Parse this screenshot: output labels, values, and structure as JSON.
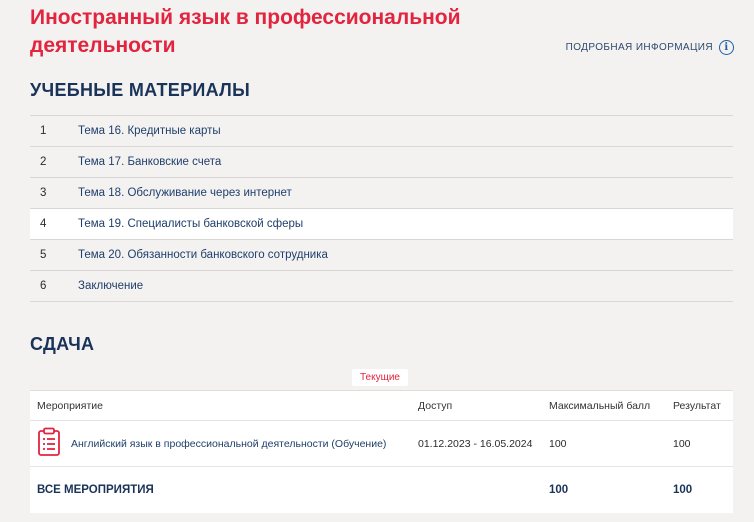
{
  "course": {
    "title": "Иностранный язык в профессиональной деятельности",
    "details_label": "ПОДРОБНАЯ ИНФОРМАЦИЯ"
  },
  "materials": {
    "heading": "УЧЕБНЫЕ МАТЕРИАЛЫ",
    "items": [
      {
        "num": "1",
        "label": "Тема 16. Кредитные карты"
      },
      {
        "num": "2",
        "label": "Тема 17. Банковские счета"
      },
      {
        "num": "3",
        "label": "Тема 18. Обслуживание через интернет"
      },
      {
        "num": "4",
        "label": "Тема 19. Специалисты банковской сферы"
      },
      {
        "num": "5",
        "label": "Тема 20. Обязанности банковского сотрудника"
      },
      {
        "num": "6",
        "label": "Заключение"
      }
    ]
  },
  "submission": {
    "heading": "СДАЧА",
    "tab_current": "Текущие",
    "columns": {
      "event": "Мероприятие",
      "access": "Доступ",
      "max_score": "Максимальный балл",
      "result": "Результат"
    },
    "rows": [
      {
        "icon": "clipboard-icon",
        "name": "Английский язык в профессиональной деятельности (Обучение)",
        "access": "01.12.2023 - 16.05.2024",
        "max_score": "100",
        "result": "100"
      }
    ],
    "total": {
      "label": "ВСЕ МЕРОПРИЯТИЯ",
      "max_score": "100",
      "result": "100"
    }
  },
  "colors": {
    "accent": "#e2243f",
    "heading": "#1a3358",
    "link": "#1f3f6a"
  }
}
